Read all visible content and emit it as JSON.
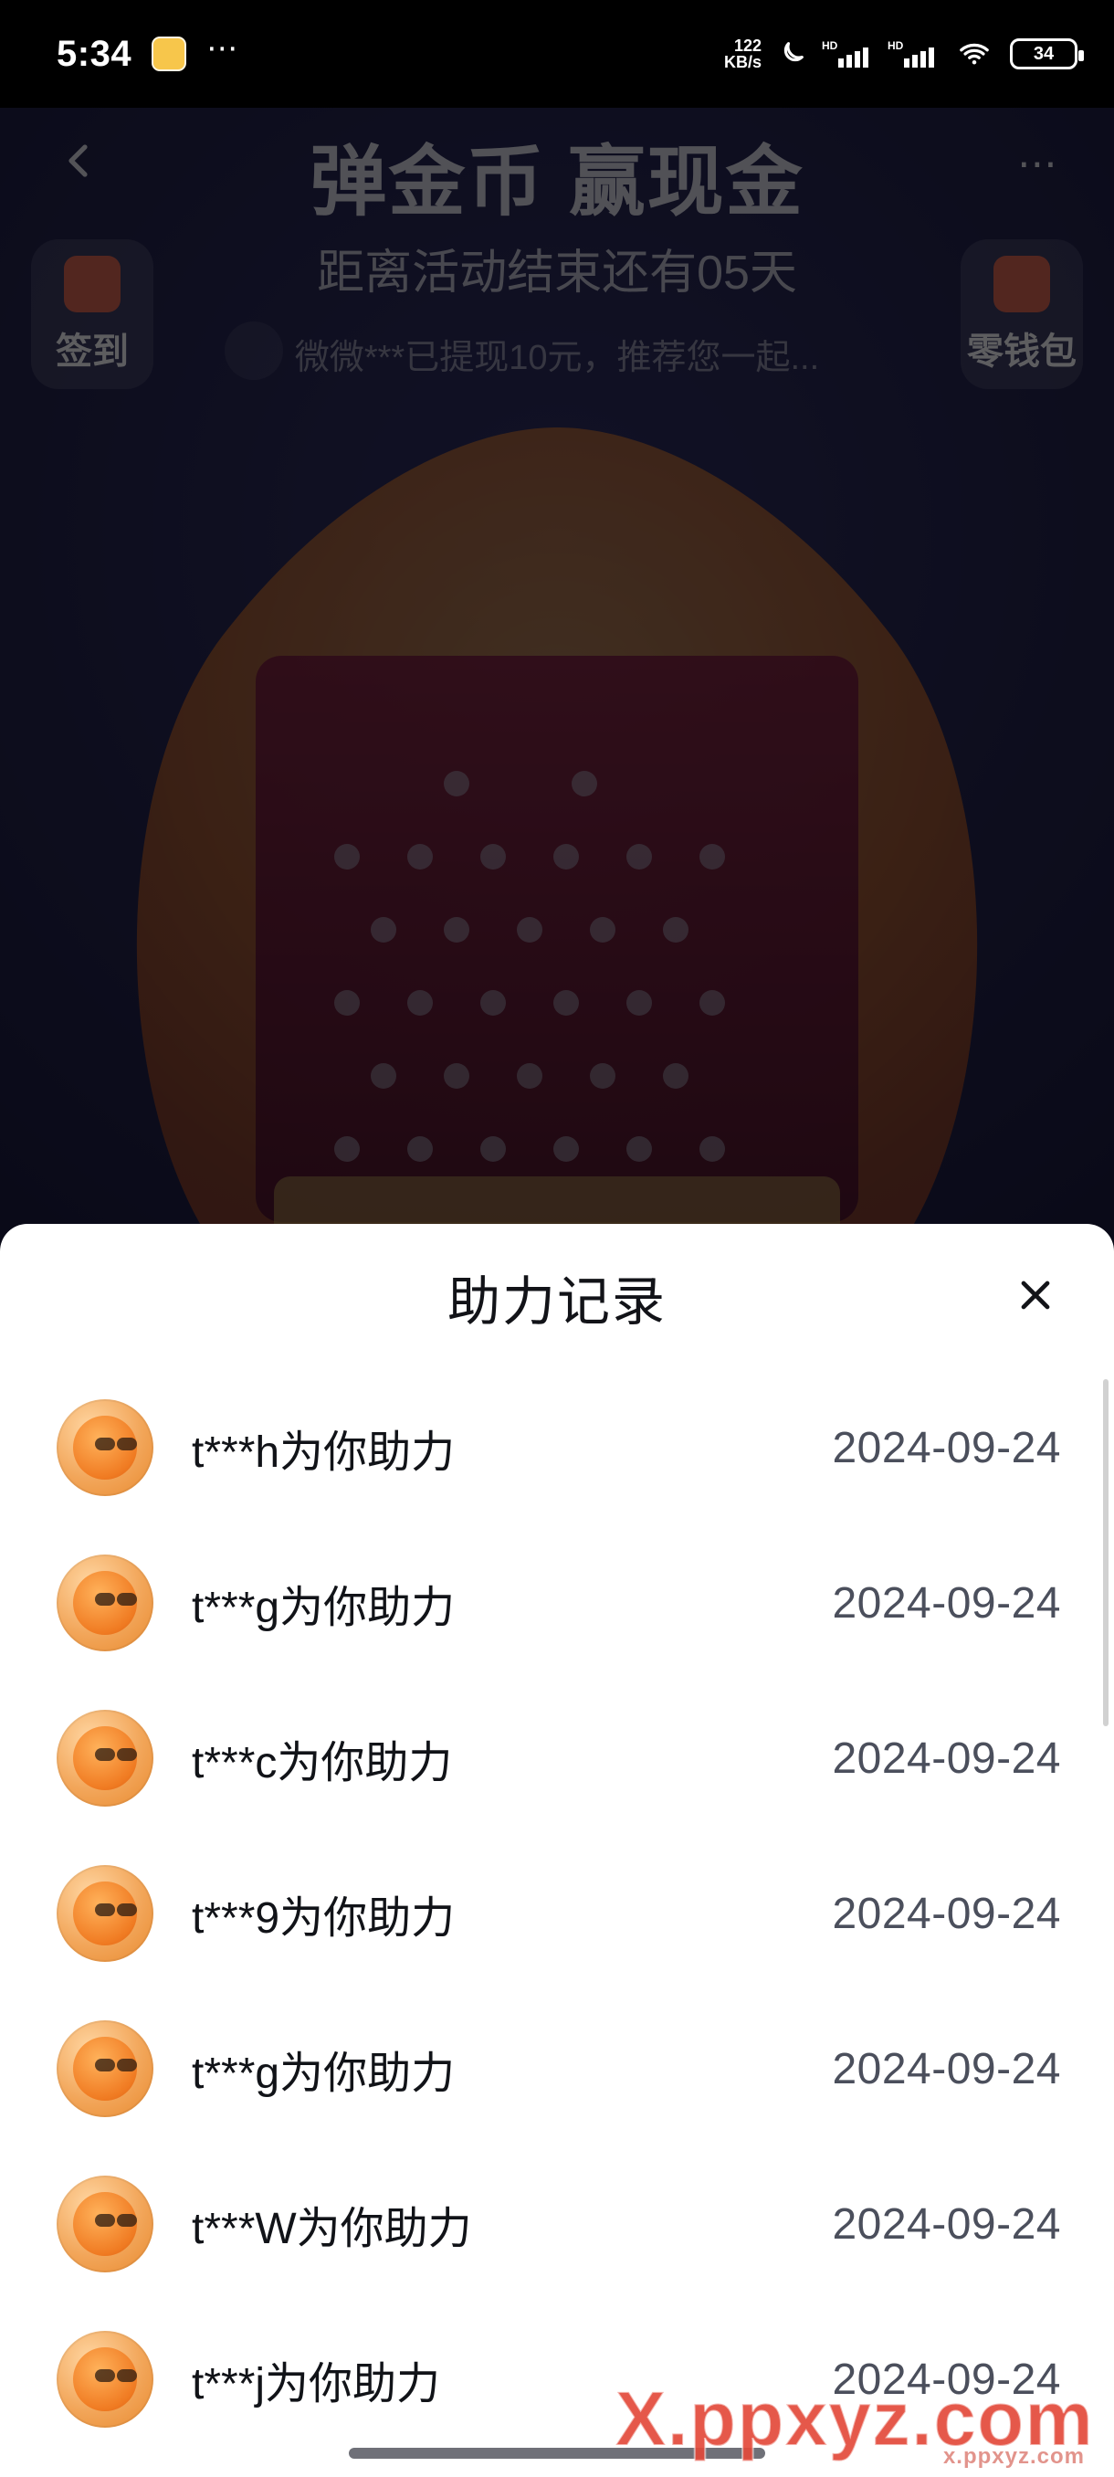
{
  "status_bar": {
    "time": "5:34",
    "network_speed_top": "122",
    "network_speed_bottom": "KB/s",
    "battery": "34",
    "icons": [
      "note-icon",
      "more-dots-icon",
      "moon-icon",
      "signal-hd-icon",
      "signal-hd-icon",
      "wifi-icon",
      "battery-icon"
    ]
  },
  "background_app": {
    "title": "弹金币 赢现金",
    "subtitle": "距离活动结束还有05天",
    "ticker": "微微***已提现10元，推荐您一起...",
    "left_button_label": "签到",
    "right_button_label": "零钱包",
    "colors": {
      "accent_orange": "#f59a2f",
      "accent_red": "#d94a3a"
    }
  },
  "sheet": {
    "title": "助力记录",
    "records": [
      {
        "text": "t***h为你助力",
        "date": "2024-09-24"
      },
      {
        "text": "t***g为你助力",
        "date": "2024-09-24"
      },
      {
        "text": "t***c为你助力",
        "date": "2024-09-24"
      },
      {
        "text": "t***9为你助力",
        "date": "2024-09-24"
      },
      {
        "text": "t***g为你助力",
        "date": "2024-09-24"
      },
      {
        "text": "t***W为你助力",
        "date": "2024-09-24"
      },
      {
        "text": "t***j为你助力",
        "date": "2024-09-24"
      }
    ]
  },
  "watermark": {
    "main": "X.ppxyz.com",
    "sub": "x.ppxyz.com"
  }
}
